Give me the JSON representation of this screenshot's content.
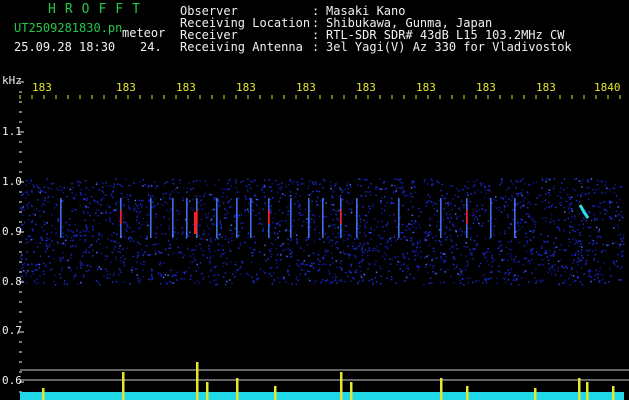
{
  "header": {
    "brand": "HROFFT",
    "file_name": "UT2509281830.pn",
    "tag": "meteor",
    "timestamp": "25.09.28 18:30",
    "count": "24.",
    "fields": [
      {
        "label": "Observer",
        "value": "Masaki Kano"
      },
      {
        "label": "Receiving Location",
        "value": "Shibukawa, Gunma, Japan"
      },
      {
        "label": "Receiver",
        "value": "RTL-SDR SDR# 43dB L15 103.2MHz CW"
      },
      {
        "label": "Receiving Antenna",
        "value": "3el Yagi(V) Az 330 for Vladivostok"
      }
    ]
  },
  "axes": {
    "y_unit": "kHz",
    "y_labels": [
      "1.1",
      "1.0",
      "0.9",
      "0.8",
      "0.7",
      "0.6"
    ],
    "x_labels": [
      "183",
      "183",
      "183",
      "183",
      "183",
      "183",
      "183",
      "183",
      "183",
      "1840"
    ]
  },
  "colors": {
    "noise_blue": "#1a2cd8",
    "hot_red": "#ff2020",
    "echo_cyan": "#30e0e0",
    "profile_yellow": "#e6e62a",
    "profile_cyan": "#20d8e8",
    "label_green": "#22c84a",
    "label_white": "#f0f0f0"
  }
}
